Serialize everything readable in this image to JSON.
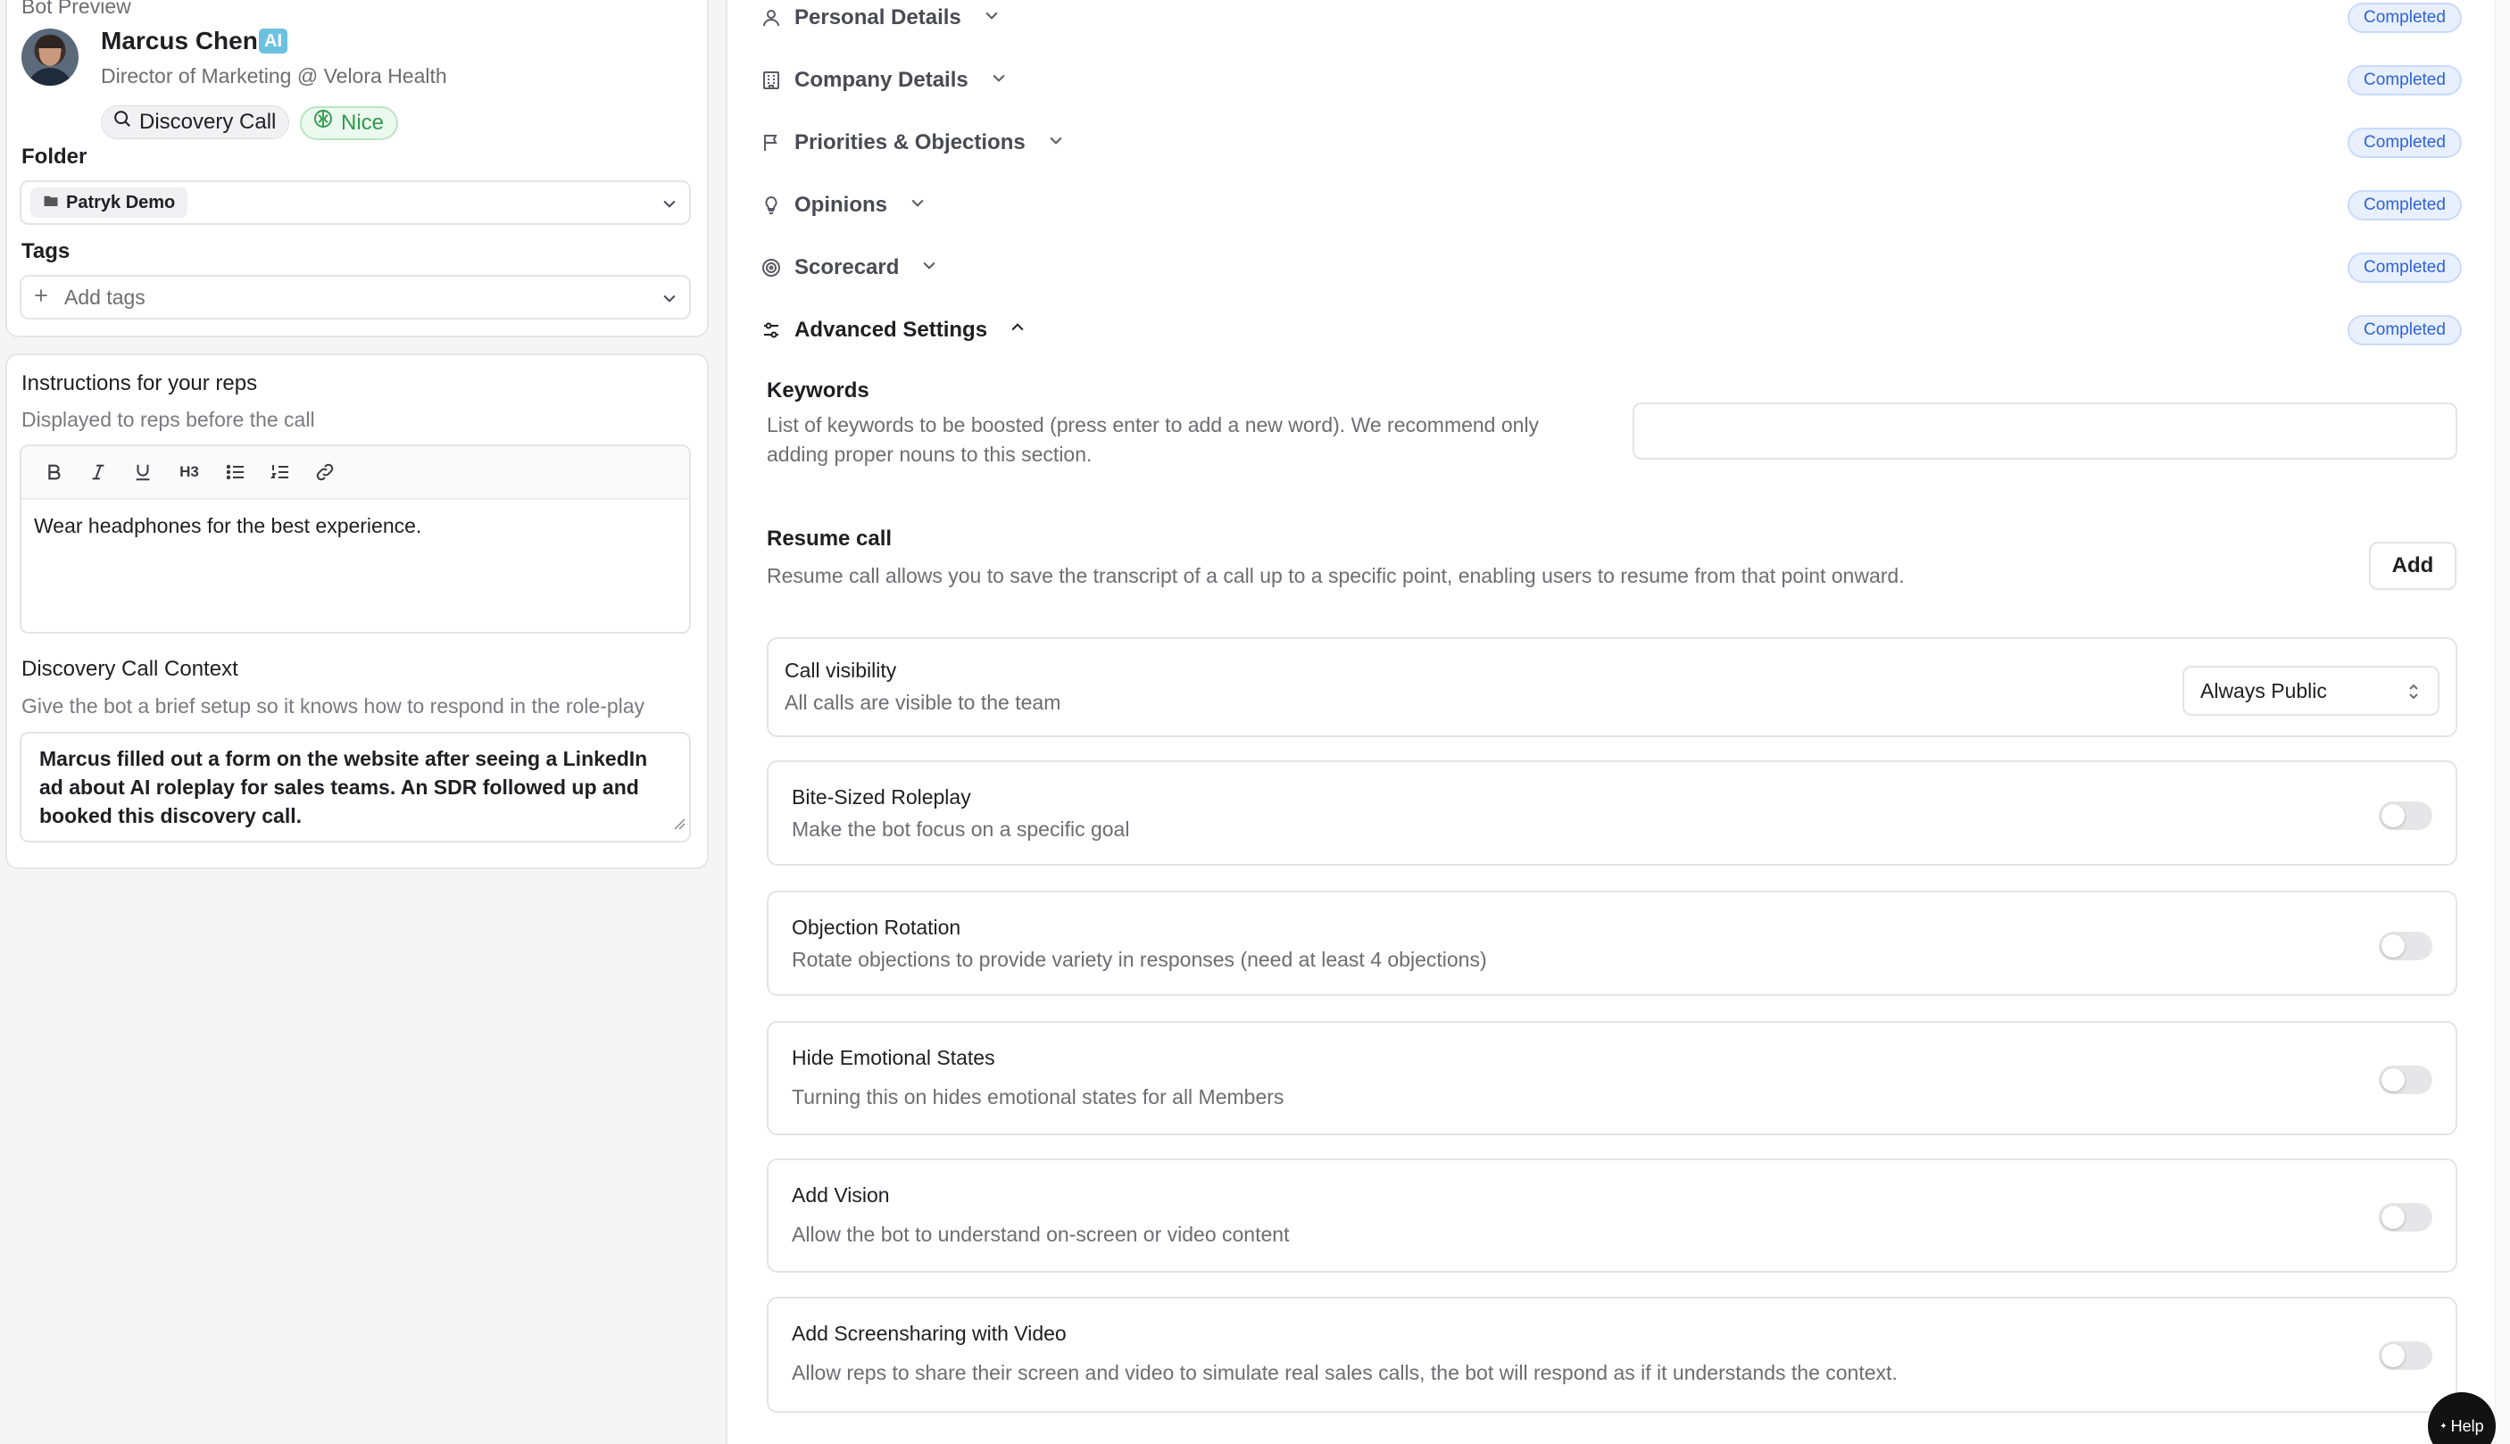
{
  "bot_preview": {
    "label": "Bot Preview",
    "name": "Marcus Chen",
    "ai_badge": "AI",
    "title": "Director of Marketing @ Velora Health",
    "call_type": "Discovery Call",
    "mood": "Nice"
  },
  "folder": {
    "label": "Folder",
    "value": "Patryk Demo"
  },
  "tags": {
    "label": "Tags",
    "placeholder": "Add tags"
  },
  "instructions": {
    "title": "Instructions for your reps",
    "subtitle": "Displayed to reps before the call",
    "toolbar": [
      "bold",
      "italic",
      "underline",
      "heading-3",
      "bullet-list",
      "numbered-list",
      "link"
    ],
    "heading_glyph": "H3",
    "text": "Wear headphones for the best experience."
  },
  "context": {
    "title": "Discovery Call Context",
    "subtitle": "Give the bot a brief setup so it knows how to respond in the role-play",
    "text": "Marcus filled out a form on the website after seeing a LinkedIn ad about AI roleplay for sales teams. An SDR followed up and booked this discovery call."
  },
  "sections": [
    {
      "label": "Personal Details",
      "icon": "user-icon",
      "status": "Completed"
    },
    {
      "label": "Company Details",
      "icon": "building-icon",
      "status": "Completed"
    },
    {
      "label": "Priorities & Objections",
      "icon": "flag-icon",
      "status": "Completed"
    },
    {
      "label": "Opinions",
      "icon": "lightbulb-icon",
      "status": "Completed"
    },
    {
      "label": "Scorecard",
      "icon": "target-icon",
      "status": "Completed"
    },
    {
      "label": "Advanced Settings",
      "icon": "sliders-icon",
      "status": "Completed",
      "expanded": true
    }
  ],
  "advanced": {
    "keywords": {
      "label": "Keywords",
      "description": "List of keywords to be boosted (press enter to add a new word). We recommend only adding proper nouns to this section.",
      "value": ""
    },
    "resume_call": {
      "label": "Resume call",
      "description": "Resume call allows you to save the transcript of a call up to a specific point, enabling users to resume from that point onward.",
      "button": "Add"
    },
    "call_visibility": {
      "label": "Call visibility",
      "description": "All calls are visible to the team",
      "value": "Always Public"
    },
    "toggles": [
      {
        "label": "Bite-Sized Roleplay",
        "description": "Make the bot focus on a specific goal",
        "on": false
      },
      {
        "label": "Objection Rotation",
        "description": "Rotate objections to provide variety in responses (need at least 4 objections)",
        "on": false
      },
      {
        "label": "Hide Emotional States",
        "description": "Turning this on hides emotional states for all Members",
        "on": false
      },
      {
        "label": "Add Vision",
        "description": "Allow the bot to understand on-screen or video content",
        "on": false
      },
      {
        "label": "Add Screensharing with Video",
        "description": "Allow reps to share their screen and video to simulate real sales calls, the bot will respond as if it understands the context.",
        "on": false
      }
    ]
  },
  "help": {
    "label": "Help"
  },
  "colors": {
    "completed_bg": "#e8f0fe",
    "completed_text": "#2f62d6",
    "nice_green": "#2f9a4b",
    "ai_badge": "#6cc1e0"
  }
}
